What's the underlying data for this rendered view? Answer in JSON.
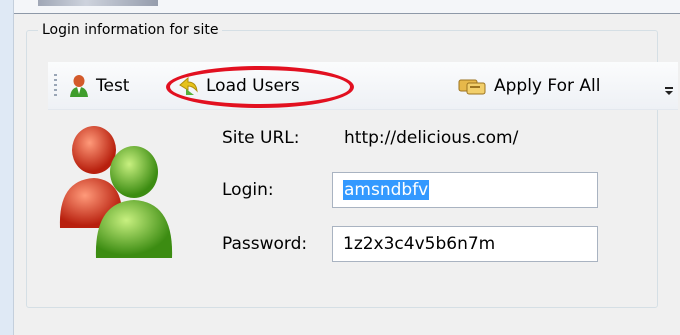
{
  "group": {
    "title": "Login information for site"
  },
  "toolbar": {
    "test_label": "Test",
    "load_users_label": "Load Users",
    "apply_for_all_label": "Apply For All",
    "icons": {
      "test": "user-icon",
      "load_users": "load-users-icon",
      "apply_for_all": "apply-all-icon",
      "overflow": "chevron-down-icon"
    }
  },
  "form": {
    "site_url_label": "Site URL:",
    "site_url_value": "http://delicious.com/",
    "login_label": "Login:",
    "login_value": "amsndbfv",
    "password_label": "Password:",
    "password_value": "1z2x3c4v5b6n7m"
  },
  "annotation": {
    "highlight_color": "#e21020"
  },
  "colors": {
    "selection": "#3399ff",
    "panel_bg": "#f0f0f0"
  }
}
